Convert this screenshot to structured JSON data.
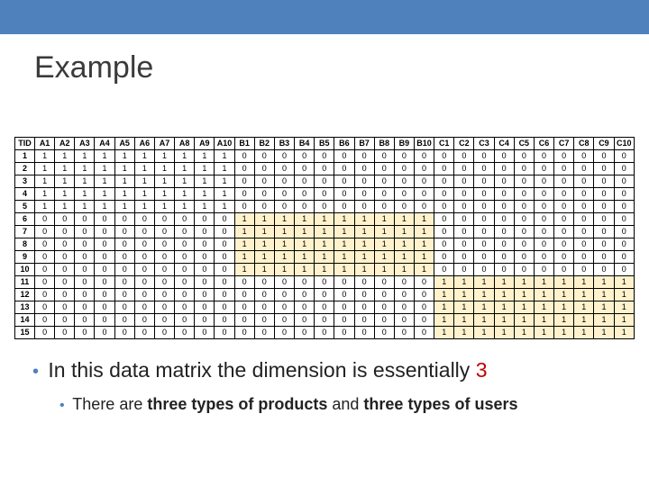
{
  "title": "Example",
  "table": {
    "tid_header": "TID",
    "columns": [
      "A1",
      "A2",
      "A3",
      "A4",
      "A5",
      "A6",
      "A7",
      "A8",
      "A9",
      "A10",
      "B1",
      "B2",
      "B3",
      "B4",
      "B5",
      "B6",
      "B7",
      "B8",
      "B9",
      "B10",
      "C1",
      "C2",
      "C3",
      "C4",
      "C5",
      "C6",
      "C7",
      "C8",
      "C9",
      "C10"
    ],
    "rows": [
      {
        "tid": "1",
        "vals": [
          "1",
          "1",
          "1",
          "1",
          "1",
          "1",
          "1",
          "1",
          "1",
          "1",
          "0",
          "0",
          "0",
          "0",
          "0",
          "0",
          "0",
          "0",
          "0",
          "0",
          "0",
          "0",
          "0",
          "0",
          "0",
          "0",
          "0",
          "0",
          "0",
          "0"
        ]
      },
      {
        "tid": "2",
        "vals": [
          "1",
          "1",
          "1",
          "1",
          "1",
          "1",
          "1",
          "1",
          "1",
          "1",
          "0",
          "0",
          "0",
          "0",
          "0",
          "0",
          "0",
          "0",
          "0",
          "0",
          "0",
          "0",
          "0",
          "0",
          "0",
          "0",
          "0",
          "0",
          "0",
          "0"
        ]
      },
      {
        "tid": "3",
        "vals": [
          "1",
          "1",
          "1",
          "1",
          "1",
          "1",
          "1",
          "1",
          "1",
          "1",
          "0",
          "0",
          "0",
          "0",
          "0",
          "0",
          "0",
          "0",
          "0",
          "0",
          "0",
          "0",
          "0",
          "0",
          "0",
          "0",
          "0",
          "0",
          "0",
          "0"
        ]
      },
      {
        "tid": "4",
        "vals": [
          "1",
          "1",
          "1",
          "1",
          "1",
          "1",
          "1",
          "1",
          "1",
          "1",
          "0",
          "0",
          "0",
          "0",
          "0",
          "0",
          "0",
          "0",
          "0",
          "0",
          "0",
          "0",
          "0",
          "0",
          "0",
          "0",
          "0",
          "0",
          "0",
          "0"
        ]
      },
      {
        "tid": "5",
        "vals": [
          "1",
          "1",
          "1",
          "1",
          "1",
          "1",
          "1",
          "1",
          "1",
          "1",
          "0",
          "0",
          "0",
          "0",
          "0",
          "0",
          "0",
          "0",
          "0",
          "0",
          "0",
          "0",
          "0",
          "0",
          "0",
          "0",
          "0",
          "0",
          "0",
          "0"
        ]
      },
      {
        "tid": "6",
        "vals": [
          "0",
          "0",
          "0",
          "0",
          "0",
          "0",
          "0",
          "0",
          "0",
          "0",
          "1",
          "1",
          "1",
          "1",
          "1",
          "1",
          "1",
          "1",
          "1",
          "1",
          "0",
          "0",
          "0",
          "0",
          "0",
          "0",
          "0",
          "0",
          "0",
          "0"
        ]
      },
      {
        "tid": "7",
        "vals": [
          "0",
          "0",
          "0",
          "0",
          "0",
          "0",
          "0",
          "0",
          "0",
          "0",
          "1",
          "1",
          "1",
          "1",
          "1",
          "1",
          "1",
          "1",
          "1",
          "1",
          "0",
          "0",
          "0",
          "0",
          "0",
          "0",
          "0",
          "0",
          "0",
          "0"
        ]
      },
      {
        "tid": "8",
        "vals": [
          "0",
          "0",
          "0",
          "0",
          "0",
          "0",
          "0",
          "0",
          "0",
          "0",
          "1",
          "1",
          "1",
          "1",
          "1",
          "1",
          "1",
          "1",
          "1",
          "1",
          "0",
          "0",
          "0",
          "0",
          "0",
          "0",
          "0",
          "0",
          "0",
          "0"
        ]
      },
      {
        "tid": "9",
        "vals": [
          "0",
          "0",
          "0",
          "0",
          "0",
          "0",
          "0",
          "0",
          "0",
          "0",
          "1",
          "1",
          "1",
          "1",
          "1",
          "1",
          "1",
          "1",
          "1",
          "1",
          "0",
          "0",
          "0",
          "0",
          "0",
          "0",
          "0",
          "0",
          "0",
          "0"
        ]
      },
      {
        "tid": "10",
        "vals": [
          "0",
          "0",
          "0",
          "0",
          "0",
          "0",
          "0",
          "0",
          "0",
          "0",
          "1",
          "1",
          "1",
          "1",
          "1",
          "1",
          "1",
          "1",
          "1",
          "1",
          "0",
          "0",
          "0",
          "0",
          "0",
          "0",
          "0",
          "0",
          "0",
          "0"
        ]
      },
      {
        "tid": "11",
        "vals": [
          "0",
          "0",
          "0",
          "0",
          "0",
          "0",
          "0",
          "0",
          "0",
          "0",
          "0",
          "0",
          "0",
          "0",
          "0",
          "0",
          "0",
          "0",
          "0",
          "0",
          "1",
          "1",
          "1",
          "1",
          "1",
          "1",
          "1",
          "1",
          "1",
          "1"
        ]
      },
      {
        "tid": "12",
        "vals": [
          "0",
          "0",
          "0",
          "0",
          "0",
          "0",
          "0",
          "0",
          "0",
          "0",
          "0",
          "0",
          "0",
          "0",
          "0",
          "0",
          "0",
          "0",
          "0",
          "0",
          "1",
          "1",
          "1",
          "1",
          "1",
          "1",
          "1",
          "1",
          "1",
          "1"
        ]
      },
      {
        "tid": "13",
        "vals": [
          "0",
          "0",
          "0",
          "0",
          "0",
          "0",
          "0",
          "0",
          "0",
          "0",
          "0",
          "0",
          "0",
          "0",
          "0",
          "0",
          "0",
          "0",
          "0",
          "0",
          "1",
          "1",
          "1",
          "1",
          "1",
          "1",
          "1",
          "1",
          "1",
          "1"
        ]
      },
      {
        "tid": "14",
        "vals": [
          "0",
          "0",
          "0",
          "0",
          "0",
          "0",
          "0",
          "0",
          "0",
          "0",
          "0",
          "0",
          "0",
          "0",
          "0",
          "0",
          "0",
          "0",
          "0",
          "0",
          "1",
          "1",
          "1",
          "1",
          "1",
          "1",
          "1",
          "1",
          "1",
          "1"
        ]
      },
      {
        "tid": "15",
        "vals": [
          "0",
          "0",
          "0",
          "0",
          "0",
          "0",
          "0",
          "0",
          "0",
          "0",
          "0",
          "0",
          "0",
          "0",
          "0",
          "0",
          "0",
          "0",
          "0",
          "0",
          "1",
          "1",
          "1",
          "1",
          "1",
          "1",
          "1",
          "1",
          "1",
          "1"
        ]
      }
    ],
    "highlight": {
      "rows_b": [
        5,
        6,
        7,
        8,
        9
      ],
      "rows_c": [
        10,
        11,
        12,
        13,
        14
      ]
    }
  },
  "bullet1": {
    "prefix": "In this data matrix the dimension is essentially ",
    "red": "3"
  },
  "bullet2": {
    "p1": "There are ",
    "b1": "three types of products",
    "p2": " and ",
    "b2": "three types of users"
  }
}
